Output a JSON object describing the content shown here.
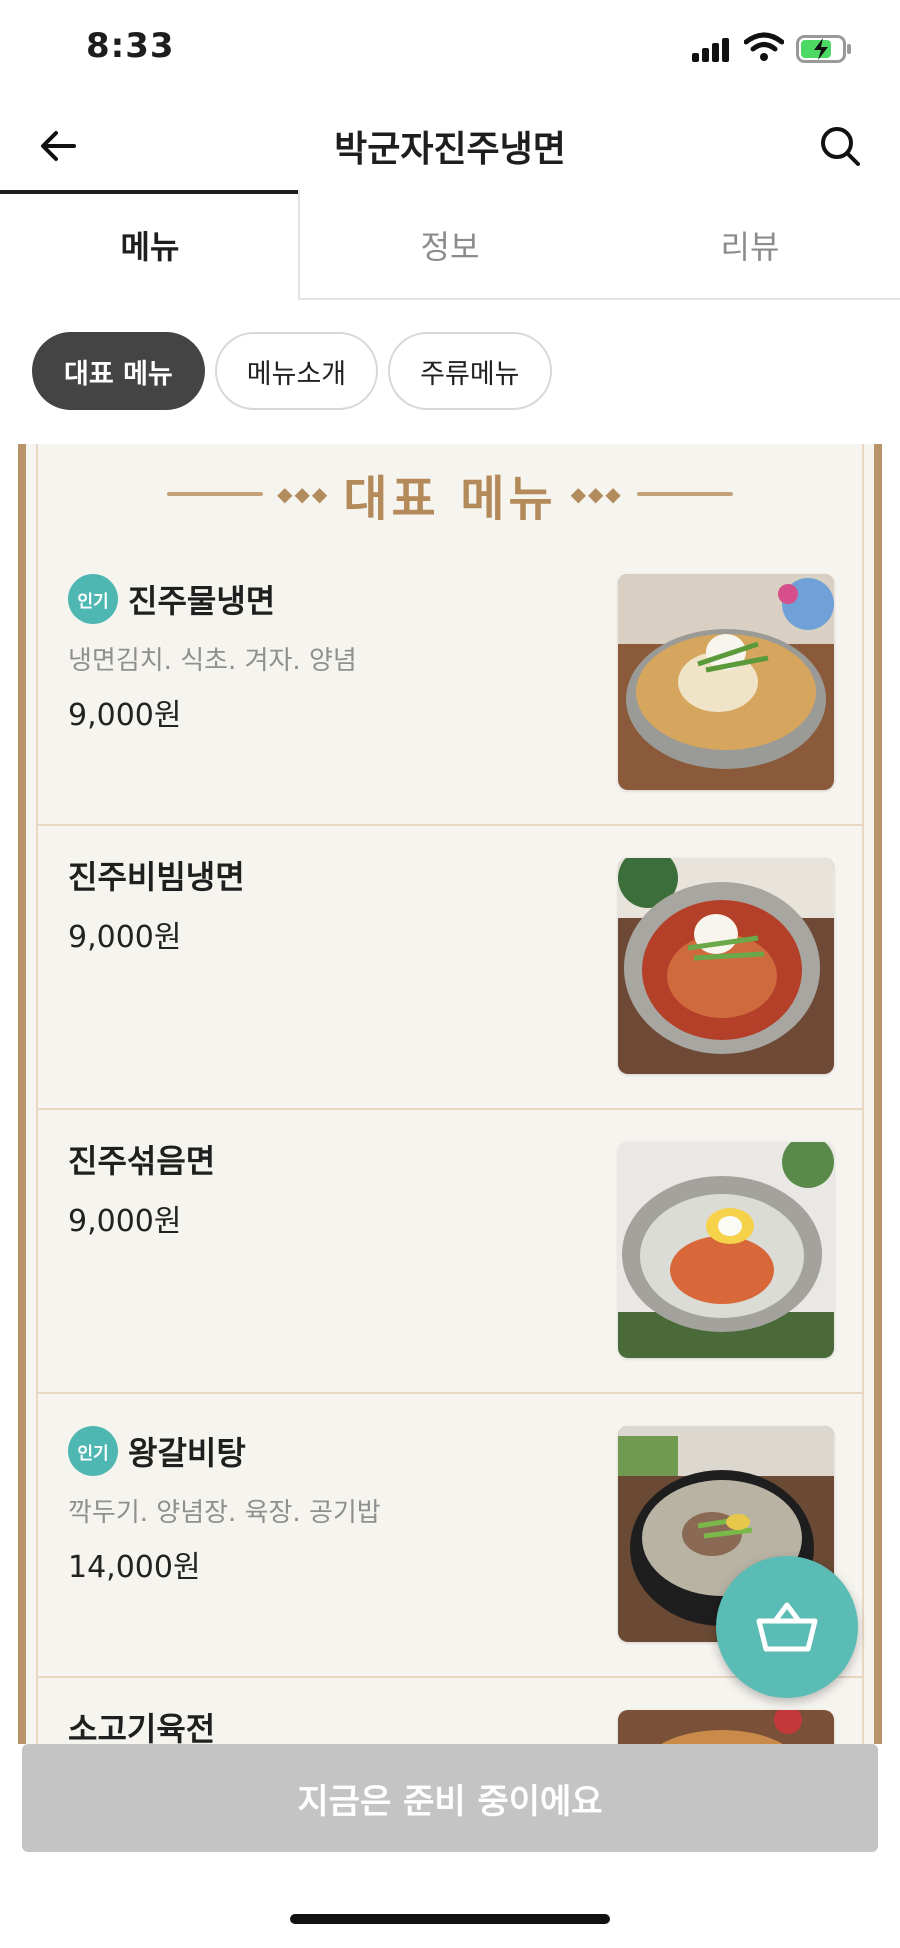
{
  "status_bar": {
    "time": "8:33"
  },
  "header": {
    "title": "박군자진주냉면",
    "back_icon": "arrow-left-icon",
    "search_icon": "search-icon"
  },
  "tabs": [
    {
      "label": "메뉴",
      "active": true
    },
    {
      "label": "정보",
      "active": false
    },
    {
      "label": "리뷰",
      "active": false
    }
  ],
  "chips": [
    {
      "label": "대표 메뉴",
      "active": true
    },
    {
      "label": "메뉴소개",
      "active": false
    },
    {
      "label": "주류메뉴",
      "active": false
    }
  ],
  "board": {
    "title": "대표 메뉴",
    "items": [
      {
        "badge": "인기",
        "name": "진주물냉면",
        "desc": "냉면김치. 식초. 겨자. 양념",
        "price": "9,000원"
      },
      {
        "badge": "",
        "name": "진주비빔냉면",
        "desc": "",
        "price": "9,000원"
      },
      {
        "badge": "",
        "name": "진주섞음면",
        "desc": "",
        "price": "9,000원"
      },
      {
        "badge": "인기",
        "name": "왕갈비탕",
        "desc": "깍두기. 양념장. 육장. 공기밥",
        "price": "14,000원"
      },
      {
        "badge": "",
        "name": "소고기육전",
        "desc": "",
        "price": ""
      }
    ]
  },
  "cart": {
    "icon": "basket-icon"
  },
  "bottom_button": {
    "label": "지금은 준비 중이에요"
  },
  "colors": {
    "accent": "#5bbcb5",
    "badge": "#4fb7b1",
    "board_gold": "#b48a5a",
    "disabled": "#c4c4c4"
  }
}
